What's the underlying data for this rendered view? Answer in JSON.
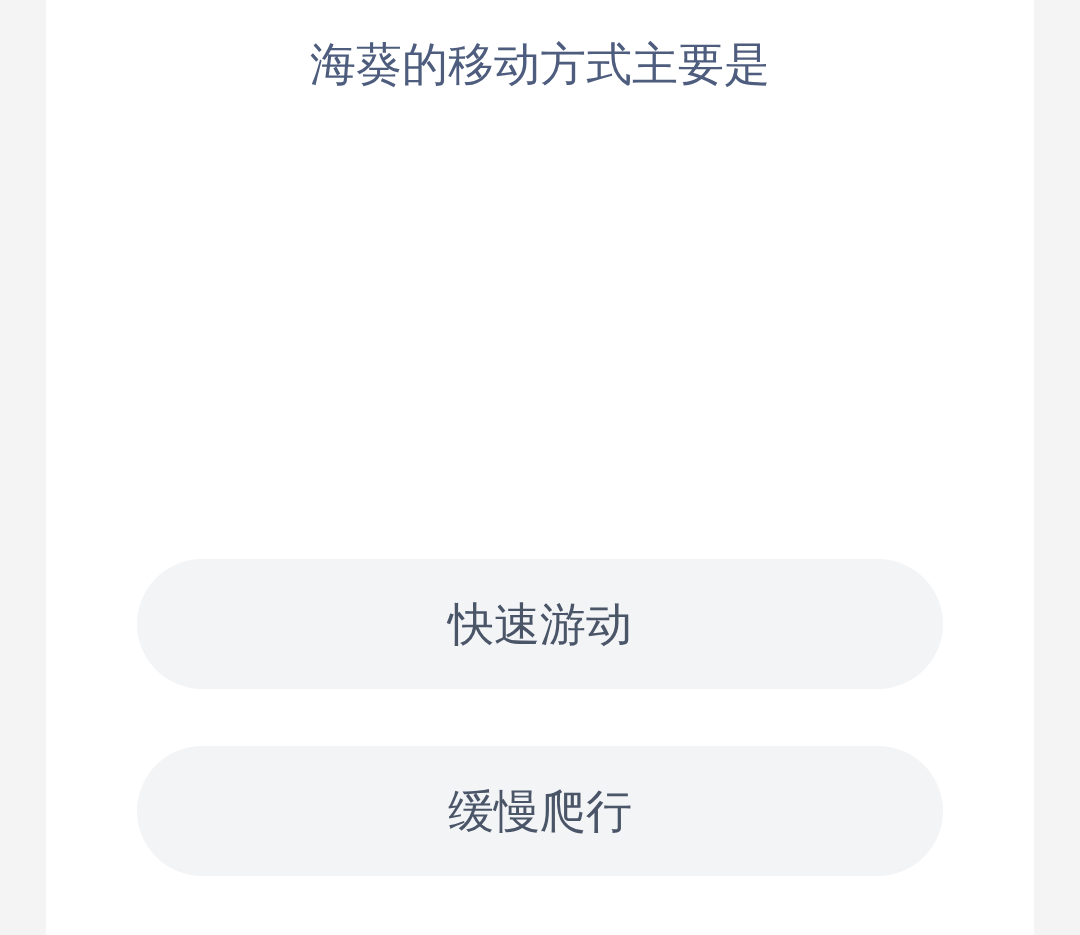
{
  "question": {
    "title": "海葵的移动方式主要是"
  },
  "options": [
    {
      "label": "快速游动"
    },
    {
      "label": "缓慢爬行"
    }
  ]
}
